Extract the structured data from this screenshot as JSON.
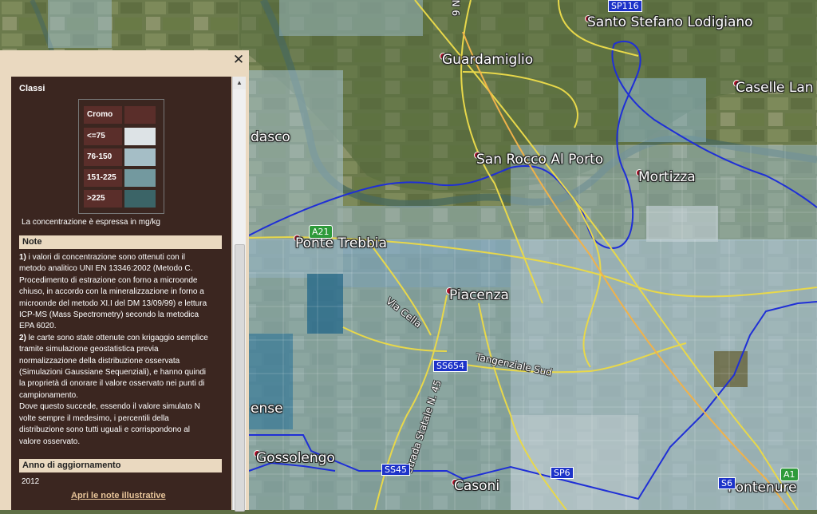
{
  "panel": {
    "close_symbol": "✕",
    "classes_title": "Classi",
    "legend": {
      "header": "Cromo",
      "rows": [
        {
          "label": "<=75",
          "color": "#dde3e6"
        },
        {
          "label": "76-150",
          "color": "#a5bec6"
        },
        {
          "label": "151-225",
          "color": "#73999f"
        },
        {
          "label": ">225",
          "color": "#3b6467"
        }
      ]
    },
    "unit_note": "La concentrazione è espressa in mg/kg",
    "notes_title": "Note",
    "note1_num": "1)",
    "note1_lines": [
      " i valori di concentrazione sono ottenuti con il",
      "metodo analitico UNI EN 13346:2002 (Metodo C.",
      "Procedimento di estrazione con forno a microonde",
      "chiuso, in accordo con la mineralizzazione in forno a",
      "microonde del metodo XI.I del DM 13/09/99) e lettura",
      "ICP-MS (Mass Spectrometry) secondo la metodica",
      "EPA 6020."
    ],
    "note2_num": "2)",
    "note2_lines": [
      " le carte sono state ottenute con krigaggio semplice",
      "tramite simulazione geostatistica previa",
      "normalizzazione della distribuzione osservata",
      "(Simulazioni Gaussiane Sequenziali), e hanno quindi",
      "la proprietà di onorare il valore osservato nei punti di",
      "campionamento.",
      "Dove questo succede, essendo il valore simulato N",
      "volte sempre il medesimo, i percentili della",
      "distribuzione sono tutti uguali e corrispondono al",
      "valore osservato."
    ],
    "year_title": "Anno di aggiornamento",
    "year_value": "2012",
    "link_text": "Apri le note illustrative"
  },
  "map": {
    "places": [
      {
        "name": "Santo Stefano Lodigiano"
      },
      {
        "name": "Guardamiglio"
      },
      {
        "name": "Caselle Lan"
      },
      {
        "name": "San Rocco Al Porto"
      },
      {
        "name": "Mortizza"
      },
      {
        "name": "dasco"
      },
      {
        "name": "Ponte Trebbia"
      },
      {
        "name": "Piacenza"
      },
      {
        "name": "ense"
      },
      {
        "name": "Gossolengo"
      },
      {
        "name": "Casoni"
      },
      {
        "name": "Pontenure"
      }
    ],
    "roads": {
      "via_cella": "Via Cella",
      "tangenziale": "Tangenziale Sud",
      "strada_statale": "Strada Statale N. 45",
      "ss654": "SS654",
      "ss45": "SS45",
      "sp6": "SP6",
      "sp116": "SP116",
      "s6": "S6",
      "a21": "A21",
      "a1": "A1",
      "n9": "9 N"
    }
  }
}
